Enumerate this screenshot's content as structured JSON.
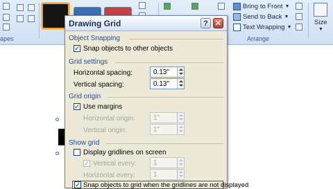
{
  "ribbon": {
    "left_group_label": "apes",
    "arrange_group_label": "Arrange",
    "size_group_label": "Size",
    "bring_to_front": "Bring to Front",
    "send_to_back": "Send to Back",
    "text_wrapping": "Text Wrapping"
  },
  "dialog": {
    "title": "Drawing Grid",
    "help": "?",
    "close": "✕",
    "object_snapping": {
      "heading": "Object Snapping",
      "snap_objects_label": "Snap objects to other objects",
      "snap_objects_checked": true
    },
    "grid_settings": {
      "heading": "Grid settings",
      "horizontal_label": "Horizontal spacing:",
      "horizontal_value": "0.13\"",
      "vertical_label": "Vertical spacing:",
      "vertical_value": "0.13\""
    },
    "grid_origin": {
      "heading": "Grid origin",
      "use_margins_label": "Use margins",
      "use_margins_checked": true,
      "horizontal_origin_label": "Horizontal origin:",
      "horizontal_origin_value": "1\"",
      "vertical_origin_label": "Vertical origin:",
      "vertical_origin_value": "1\""
    },
    "show_grid": {
      "heading": "Show grid",
      "display_gridlines_label": "Display gridlines on screen",
      "display_gridlines_checked": false,
      "vertical_every_label": "Vertical every:",
      "vertical_every_value": "1",
      "horizontal_every_label": "Horizontal every:",
      "horizontal_every_value": "1",
      "snap_to_grid_label": "Snap objects to grid when the gridlines are not displayed",
      "snap_to_grid_checked": true
    }
  },
  "colors": {
    "accent": "#1f4c9b",
    "dialog_bg": "#ece9d8",
    "ribbon_bg": "#dce7f6"
  }
}
